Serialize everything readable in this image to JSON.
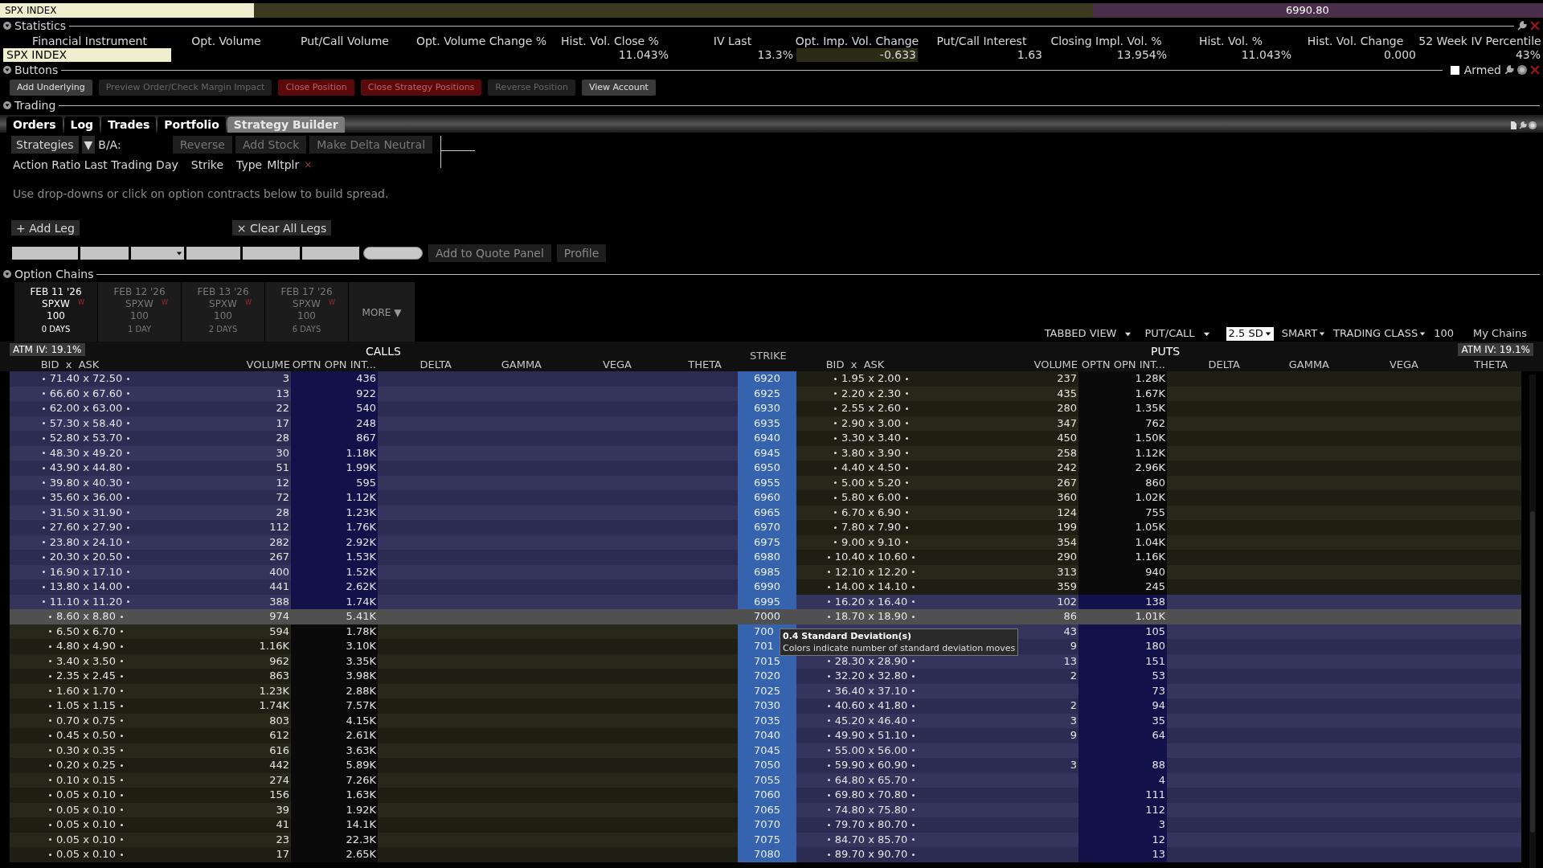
{
  "quote_row": {
    "instrument": "SPX INDEX",
    "last": "6990.80"
  },
  "statistics": {
    "title": "Statistics",
    "columns": [
      {
        "label": "Financial Instrument",
        "value": "SPX INDEX",
        "kind": "instrument"
      },
      {
        "label": "Opt. Volume",
        "kind": "number"
      },
      {
        "label": "Put/Call Volume",
        "kind": "number"
      },
      {
        "label": "Opt. Volume Change %",
        "kind": "number"
      },
      {
        "label": "Hist. Vol. Close %",
        "value": "11.043%",
        "kind": "number"
      },
      {
        "label": "IV Last",
        "value": "13.3%",
        "kind": "number"
      },
      {
        "label": "Opt. Imp. Vol. Change",
        "value": "-0.633",
        "kind": "shaded"
      },
      {
        "label": "Put/Call Interest",
        "value": "1.63",
        "kind": "number"
      },
      {
        "label": "Closing Impl. Vol. %",
        "value": "13.954%",
        "kind": "number"
      },
      {
        "label": "Hist. Vol. %",
        "value": "11.043%",
        "kind": "number"
      },
      {
        "label": "Hist. Vol. Change",
        "value": "0.000",
        "kind": "number"
      },
      {
        "label": "52 Week IV Percentile",
        "value": "43%",
        "kind": "number"
      }
    ]
  },
  "buttons_section": {
    "title": "Buttons",
    "armed": {
      "label": "Armed",
      "checked": false
    },
    "buttons": [
      {
        "label": "Add Underlying",
        "kind": "normal"
      },
      {
        "label": "Preview Order/Check Margin Impact",
        "kind": "disabled"
      },
      {
        "label": "Close Position",
        "kind": "danger"
      },
      {
        "label": "Close Strategy Positions",
        "kind": "danger"
      },
      {
        "label": "Reverse Position",
        "kind": "disabled"
      },
      {
        "label": "View Account",
        "kind": "normal"
      }
    ]
  },
  "trading": {
    "title": "Trading",
    "tabs": [
      {
        "label": "Orders",
        "selected": false
      },
      {
        "label": "Log",
        "selected": false
      },
      {
        "label": "Trades",
        "selected": false
      },
      {
        "label": "Portfolio",
        "selected": false
      },
      {
        "label": "Strategy Builder",
        "selected": true
      }
    ],
    "strategies": "Strategies",
    "caret": "▼",
    "ba_label": "B/A:",
    "actions": [
      "Reverse",
      "Add Stock",
      "Make Delta Neutral"
    ],
    "leg_columns": [
      "Action Ratio Last Trading Day",
      "Strike",
      "Type",
      "Mltplr"
    ],
    "remove": "×",
    "hint": "Use drop-downs or click on option contracts below to build spread.",
    "add_leg": "+ Add Leg",
    "clear_legs": "× Clear All Legs",
    "bottom_buttons": [
      "Add to Quote Panel",
      "Profile"
    ]
  },
  "option_chains": {
    "title": "Option Chains",
    "expiries": [
      {
        "date": "FEB 11 '26",
        "class": "SPXW",
        "badge": "W",
        "multiplier": "100",
        "days": "0 DAYS",
        "selected": true
      },
      {
        "date": "FEB 12 '26",
        "class": "SPXW",
        "badge": "W",
        "multiplier": "100",
        "days": "1 DAY",
        "selected": false
      },
      {
        "date": "FEB 13 '26",
        "class": "SPXW",
        "badge": "W",
        "multiplier": "100",
        "days": "2 DAYS",
        "selected": false
      },
      {
        "date": "FEB 17 '26",
        "class": "SPXW",
        "badge": "W",
        "multiplier": "100",
        "days": "6 DAYS",
        "selected": false
      }
    ],
    "more": "MORE ▼",
    "toolbar": {
      "view": "TABBED VIEW",
      "layout": "PUT/CALL",
      "range": "2.5 SD",
      "exchange": "SMART",
      "trading_class_label": "TRADING CLASS",
      "trading_class": "100",
      "my_chains": "My Chains"
    },
    "calls_atm_iv": "ATM IV: 19.1%",
    "puts_atm_iv": "ATM IV: 19.1%",
    "calls_title": "CALLS",
    "puts_title": "PUTS",
    "strike_title": "STRIKE",
    "calls_columns": [
      "BID  x  ASK",
      "VOLUME",
      "OPTN OPN INT...",
      "DELTA",
      "GAMMA",
      "VEGA",
      "THETA"
    ],
    "puts_columns": [
      "BID  x  ASK",
      "VOLUME",
      "OPTN OPN INT...",
      "DELTA",
      "GAMMA",
      "VEGA",
      "THETA"
    ],
    "rows": [
      {
        "strike": "6920",
        "call_bid_ask": "71.40 x 72.50",
        "call_volume": "3",
        "call_oi": "436",
        "put_bid_ask": "1.95 x 2.00",
        "put_volume": "237",
        "put_oi": "1.28K",
        "call_itm": true,
        "put_itm": false,
        "hovered": false
      },
      {
        "strike": "6925",
        "call_bid_ask": "66.60 x 67.60",
        "call_volume": "13",
        "call_oi": "922",
        "put_bid_ask": "2.20 x 2.30",
        "put_volume": "435",
        "put_oi": "1.67K",
        "call_itm": true,
        "put_itm": false,
        "hovered": false
      },
      {
        "strike": "6930",
        "call_bid_ask": "62.00 x 63.00",
        "call_volume": "22",
        "call_oi": "540",
        "put_bid_ask": "2.55 x 2.60",
        "put_volume": "280",
        "put_oi": "1.35K",
        "call_itm": true,
        "put_itm": false,
        "hovered": false
      },
      {
        "strike": "6935",
        "call_bid_ask": "57.30 x 58.40",
        "call_volume": "17",
        "call_oi": "248",
        "put_bid_ask": "2.90 x 3.00",
        "put_volume": "347",
        "put_oi": "762",
        "call_itm": true,
        "put_itm": false,
        "hovered": false
      },
      {
        "strike": "6940",
        "call_bid_ask": "52.80 x 53.70",
        "call_volume": "28",
        "call_oi": "867",
        "put_bid_ask": "3.30 x 3.40",
        "put_volume": "450",
        "put_oi": "1.50K",
        "call_itm": true,
        "put_itm": false,
        "hovered": false
      },
      {
        "strike": "6945",
        "call_bid_ask": "48.30 x 49.20",
        "call_volume": "30",
        "call_oi": "1.18K",
        "put_bid_ask": "3.80 x 3.90",
        "put_volume": "258",
        "put_oi": "1.12K",
        "call_itm": true,
        "put_itm": false,
        "hovered": false
      },
      {
        "strike": "6950",
        "call_bid_ask": "43.90 x 44.80",
        "call_volume": "51",
        "call_oi": "1.99K",
        "put_bid_ask": "4.40 x 4.50",
        "put_volume": "242",
        "put_oi": "2.96K",
        "call_itm": true,
        "put_itm": false,
        "hovered": false
      },
      {
        "strike": "6955",
        "call_bid_ask": "39.80 x 40.30",
        "call_volume": "12",
        "call_oi": "595",
        "put_bid_ask": "5.00 x 5.20",
        "put_volume": "267",
        "put_oi": "860",
        "call_itm": true,
        "put_itm": false,
        "hovered": false
      },
      {
        "strike": "6960",
        "call_bid_ask": "35.60 x 36.00",
        "call_volume": "72",
        "call_oi": "1.12K",
        "put_bid_ask": "5.80 x 6.00",
        "put_volume": "360",
        "put_oi": "1.02K",
        "call_itm": true,
        "put_itm": false,
        "hovered": false
      },
      {
        "strike": "6965",
        "call_bid_ask": "31.50 x 31.90",
        "call_volume": "28",
        "call_oi": "1.23K",
        "put_bid_ask": "6.70 x 6.90",
        "put_volume": "124",
        "put_oi": "755",
        "call_itm": true,
        "put_itm": false,
        "hovered": false
      },
      {
        "strike": "6970",
        "call_bid_ask": "27.60 x 27.90",
        "call_volume": "112",
        "call_oi": "1.76K",
        "put_bid_ask": "7.80 x 7.90",
        "put_volume": "199",
        "put_oi": "1.05K",
        "call_itm": true,
        "put_itm": false,
        "hovered": false
      },
      {
        "strike": "6975",
        "call_bid_ask": "23.80 x 24.10",
        "call_volume": "282",
        "call_oi": "2.92K",
        "put_bid_ask": "9.00 x 9.10",
        "put_volume": "354",
        "put_oi": "1.04K",
        "call_itm": true,
        "put_itm": false,
        "hovered": false
      },
      {
        "strike": "6980",
        "call_bid_ask": "20.30 x 20.50",
        "call_volume": "267",
        "call_oi": "1.53K",
        "put_bid_ask": "10.40 x 10.60",
        "put_volume": "290",
        "put_oi": "1.16K",
        "call_itm": true,
        "put_itm": false,
        "hovered": false
      },
      {
        "strike": "6985",
        "call_bid_ask": "16.90 x 17.10",
        "call_volume": "400",
        "call_oi": "1.52K",
        "put_bid_ask": "12.10 x 12.20",
        "put_volume": "313",
        "put_oi": "940",
        "call_itm": true,
        "put_itm": false,
        "hovered": false
      },
      {
        "strike": "6990",
        "call_bid_ask": "13.80 x 14.00",
        "call_volume": "441",
        "call_oi": "2.62K",
        "put_bid_ask": "14.00 x 14.10",
        "put_volume": "359",
        "put_oi": "245",
        "call_itm": true,
        "put_itm": false,
        "hovered": false
      },
      {
        "strike": "6995",
        "call_bid_ask": "11.10 x 11.20",
        "call_volume": "388",
        "call_oi": "1.74K",
        "put_bid_ask": "16.20 x 16.40",
        "put_volume": "102",
        "put_oi": "138",
        "call_itm": true,
        "put_itm": true,
        "hovered": false
      },
      {
        "strike": "7000",
        "call_bid_ask": "8.60 x 8.80",
        "call_volume": "974",
        "call_oi": "5.41K",
        "put_bid_ask": "18.70 x 18.90",
        "put_volume": "86",
        "put_oi": "1.01K",
        "call_itm": false,
        "put_itm": true,
        "hovered": true
      },
      {
        "strike": "700",
        "call_bid_ask": "6.50 x 6.70",
        "call_volume": "594",
        "call_oi": "1.78K",
        "put_volume": "43",
        "put_oi": "105",
        "call_itm": false,
        "put_itm": true,
        "hovered": false
      },
      {
        "strike": "701",
        "call_bid_ask": "4.80 x 4.90",
        "call_volume": "1.16K",
        "call_oi": "3.10K",
        "put_volume": "9",
        "put_oi": "180",
        "call_itm": false,
        "put_itm": true,
        "hovered": false
      },
      {
        "strike": "7015",
        "call_bid_ask": "3.40 x 3.50",
        "call_volume": "962",
        "call_oi": "3.35K",
        "put_bid_ask": "28.30 x 28.90",
        "put_volume": "13",
        "put_oi": "151",
        "call_itm": false,
        "put_itm": true,
        "hovered": false
      },
      {
        "strike": "7020",
        "call_bid_ask": "2.35 x 2.45",
        "call_volume": "863",
        "call_oi": "3.98K",
        "put_bid_ask": "32.20 x 32.80",
        "put_volume": "2",
        "put_oi": "53",
        "call_itm": false,
        "put_itm": true,
        "hovered": false
      },
      {
        "strike": "7025",
        "call_bid_ask": "1.60 x 1.70",
        "call_volume": "1.23K",
        "call_oi": "2.88K",
        "put_bid_ask": "36.40 x 37.10",
        "put_oi": "73",
        "call_itm": false,
        "put_itm": true,
        "hovered": false
      },
      {
        "strike": "7030",
        "call_bid_ask": "1.05 x 1.15",
        "call_volume": "1.74K",
        "call_oi": "7.57K",
        "put_bid_ask": "40.60 x 41.80",
        "put_volume": "2",
        "put_oi": "94",
        "call_itm": false,
        "put_itm": true,
        "hovered": false
      },
      {
        "strike": "7035",
        "call_bid_ask": "0.70 x 0.75",
        "call_volume": "803",
        "call_oi": "4.15K",
        "put_bid_ask": "45.20 x 46.40",
        "put_volume": "3",
        "put_oi": "35",
        "call_itm": false,
        "put_itm": true,
        "hovered": false
      },
      {
        "strike": "7040",
        "call_bid_ask": "0.45 x 0.50",
        "call_volume": "612",
        "call_oi": "2.61K",
        "put_bid_ask": "49.90 x 51.10",
        "put_volume": "9",
        "put_oi": "64",
        "call_itm": false,
        "put_itm": true,
        "hovered": false
      },
      {
        "strike": "7045",
        "call_bid_ask": "0.30 x 0.35",
        "call_volume": "616",
        "call_oi": "3.63K",
        "put_bid_ask": "55.00 x 56.00",
        "call_itm": false,
        "put_itm": true,
        "hovered": false
      },
      {
        "strike": "7050",
        "call_bid_ask": "0.20 x 0.25",
        "call_volume": "442",
        "call_oi": "5.89K",
        "put_bid_ask": "59.90 x 60.90",
        "put_volume": "3",
        "put_oi": "88",
        "call_itm": false,
        "put_itm": true,
        "hovered": false
      },
      {
        "strike": "7055",
        "call_bid_ask": "0.10 x 0.15",
        "call_volume": "274",
        "call_oi": "7.26K",
        "put_bid_ask": "64.80 x 65.70",
        "put_oi": "4",
        "call_itm": false,
        "put_itm": true,
        "hovered": false
      },
      {
        "strike": "7060",
        "call_bid_ask": "0.05 x 0.10",
        "call_volume": "156",
        "call_oi": "1.63K",
        "put_bid_ask": "69.80 x 70.80",
        "put_oi": "111",
        "call_itm": false,
        "put_itm": true,
        "hovered": false
      },
      {
        "strike": "7065",
        "call_bid_ask": "0.05 x 0.10",
        "call_volume": "39",
        "call_oi": "1.92K",
        "put_bid_ask": "74.80 x 75.80",
        "put_oi": "112",
        "call_itm": false,
        "put_itm": true,
        "hovered": false
      },
      {
        "strike": "7070",
        "call_bid_ask": "0.05 x 0.10",
        "call_volume": "41",
        "call_oi": "14.1K",
        "put_bid_ask": "79.70 x 80.70",
        "put_oi": "3",
        "call_itm": false,
        "put_itm": true,
        "hovered": false
      },
      {
        "strike": "7075",
        "call_bid_ask": "0.05 x 0.10",
        "call_volume": "23",
        "call_oi": "22.3K",
        "put_bid_ask": "84.70 x 85.70",
        "put_oi": "12",
        "call_itm": false,
        "put_itm": true,
        "hovered": false
      },
      {
        "strike": "7080",
        "call_bid_ask": "0.05 x 0.10",
        "call_volume": "17",
        "call_oi": "2.65K",
        "put_bid_ask": "89.70 x 90.70",
        "put_oi": "13",
        "call_itm": false,
        "put_itm": true,
        "hovered": false
      }
    ],
    "tooltip": {
      "title": "0.4 Standard Deviation(s)",
      "text": "Colors indicate number of standard deviation moves"
    }
  }
}
